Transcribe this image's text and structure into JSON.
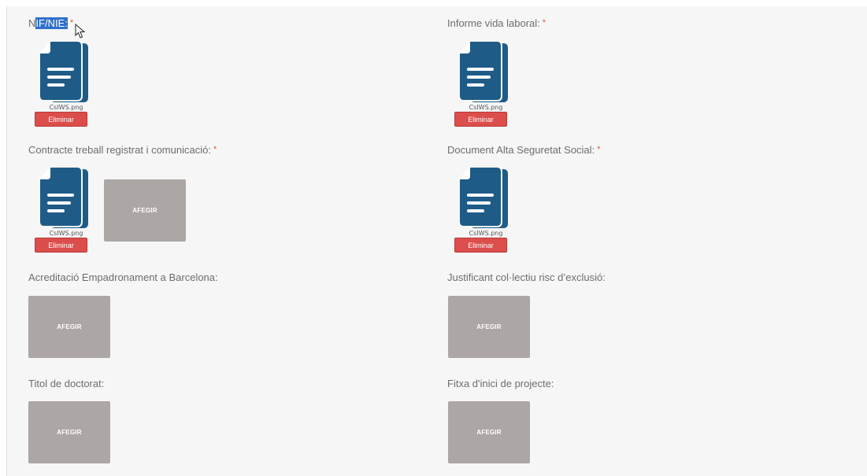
{
  "colors": {
    "file_icon": "#1f5b87",
    "delete_button": "#dc4e4b",
    "add_button": "#aca6a5",
    "required_mark": "#e0534a",
    "selection": "#2f6fc9"
  },
  "fields": {
    "nif": {
      "label_sel_prefix": "N",
      "label_selected": "IF/NIE:",
      "required": "*",
      "file_name": "CsIWS.png",
      "delete": "Eliminar"
    },
    "informe": {
      "label": "Informe vida laboral:",
      "required": "*",
      "file_name": "CsIWS.png",
      "delete": "Eliminar"
    },
    "contracte": {
      "label": "Contracte treball registrat i comunicació:",
      "required": "*",
      "file_name": "CsIWS.png",
      "delete": "Eliminar",
      "add": "AFEGIR"
    },
    "alta": {
      "label": "Document Alta Seguretat Social:",
      "required": "*",
      "file_name": "CsIWS.png",
      "delete": "Eliminar"
    },
    "empadronament": {
      "label": "Acreditació Empadronament a Barcelona:",
      "add": "AFEGIR"
    },
    "justificant": {
      "label": "Justificant col·lectiu risc d’exclusió:",
      "add": "AFEGIR"
    },
    "doctorat": {
      "label": "Titol de doctorat:",
      "add": "AFEGIR"
    },
    "fitxa": {
      "label": "Fitxa d'inici de projecte:",
      "add": "AFEGIR"
    }
  },
  "icons": {
    "file": "document-file-icon",
    "cursor": "mouse-pointer-icon"
  }
}
